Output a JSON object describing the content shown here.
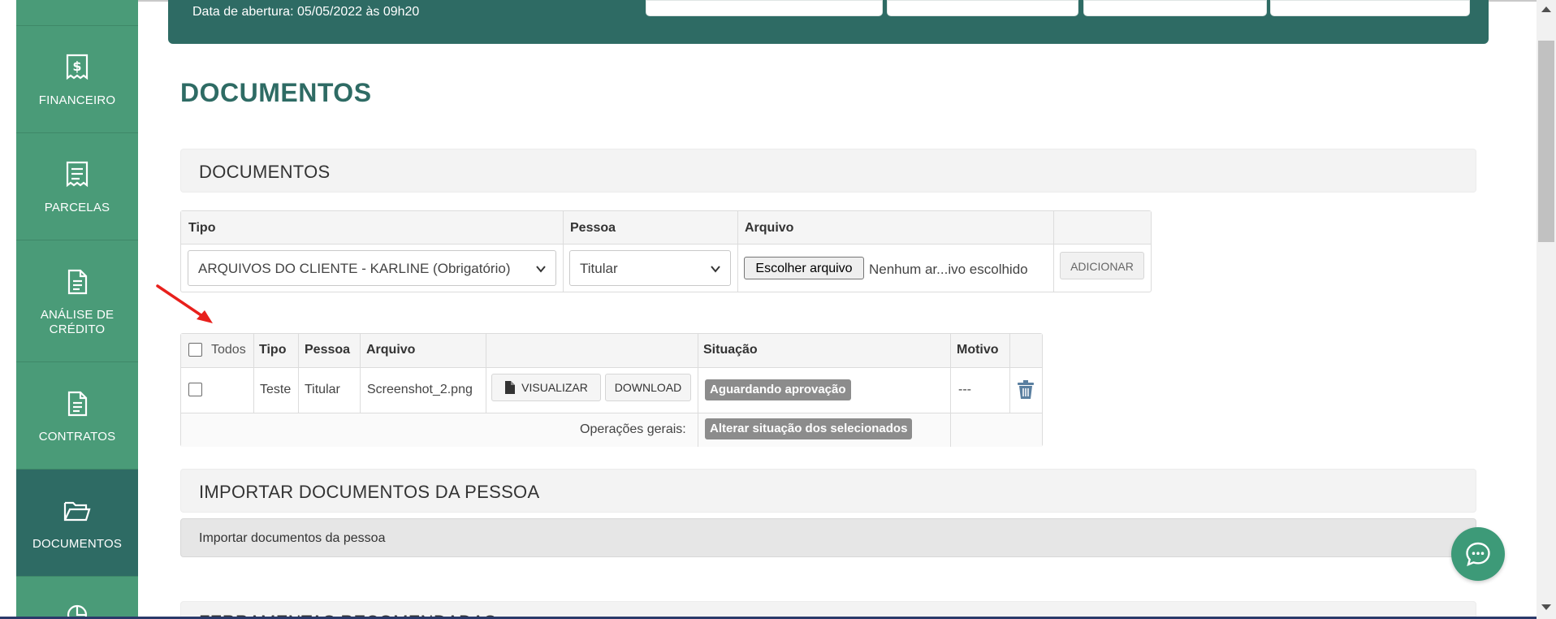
{
  "sidebar": {
    "items": [
      {
        "label": "FINANCEIRO",
        "icon": "receipt-dollar-icon"
      },
      {
        "label": "PARCELAS",
        "icon": "receipt-list-icon"
      },
      {
        "label": "ANÁLISE DE CRÉDITO",
        "icon": "document-icon"
      },
      {
        "label": "CONTRATOS",
        "icon": "document-icon"
      },
      {
        "label": "DOCUMENTOS",
        "icon": "folder-open-icon",
        "active": true
      }
    ]
  },
  "banner": {
    "date_text": "Data de abertura: 05/05/2022 às 09h20"
  },
  "page": {
    "title": "DOCUMENTOS"
  },
  "documents_panel": {
    "title": "DOCUMENTOS"
  },
  "upload": {
    "headers": {
      "tipo": "Tipo",
      "pessoa": "Pessoa",
      "arquivo": "Arquivo"
    },
    "tipo_selected": "ARQUIVOS DO CLIENTE - KARLINE (Obrigatório)",
    "pessoa_selected": "Titular",
    "file_button": "Escolher arquivo",
    "file_status": "Nenhum ar...ivo escolhido",
    "add_button": "ADICIONAR"
  },
  "files_table": {
    "headers": {
      "todos": "Todos",
      "tipo": "Tipo",
      "pessoa": "Pessoa",
      "arquivo": "Arquivo",
      "situacao": "Situação",
      "motivo": "Motivo"
    },
    "rows": [
      {
        "tipo": "Teste",
        "pessoa": "Titular",
        "arquivo": "Screenshot_2.png",
        "view_button": "VISUALIZAR",
        "download_button": "DOWNLOAD",
        "situacao": "Aguardando aprovação",
        "motivo": "---"
      }
    ],
    "footer": {
      "label": "Operações gerais:",
      "action": "Alterar situação dos selecionados"
    }
  },
  "import_panel": {
    "title": "IMPORTAR DOCUMENTOS DA PESSOA",
    "collapse_label": "Importar documentos da pessoa"
  },
  "next_panel": {
    "title_partial": "FERRAMENTAS RECOMENDADAS"
  },
  "colors": {
    "primary": "#2e6b64",
    "sidebar": "#4a9b78",
    "badge": "#8c8c8c",
    "annotation_arrow": "#e8201c"
  }
}
